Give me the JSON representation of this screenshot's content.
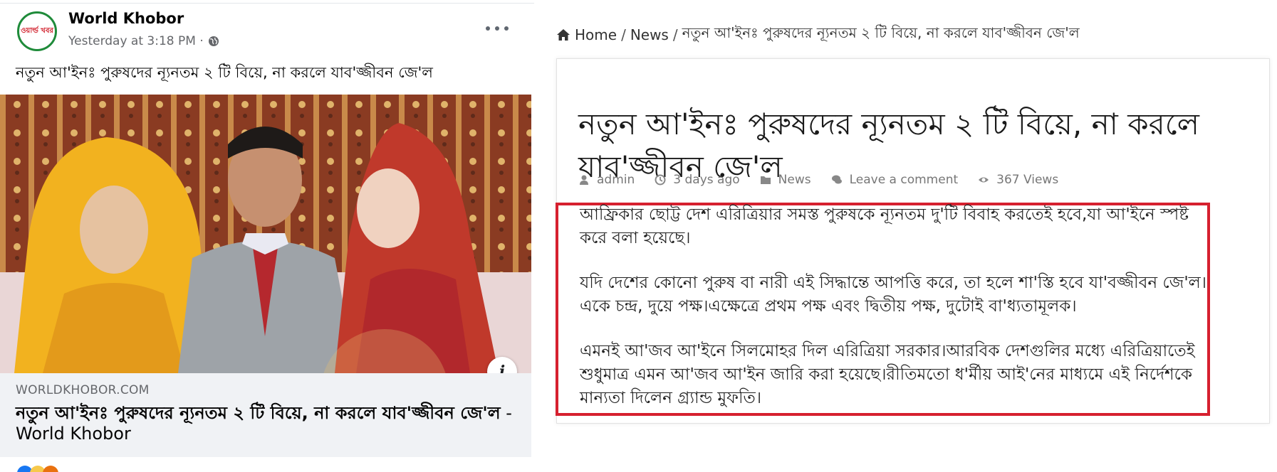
{
  "post": {
    "page_name": "World Khobor",
    "avatar_text": "ওয়ার্ল্ড খবর",
    "timestamp": "Yesterday at 3:18 PM ·",
    "more_icon": "more-horizontal-icon",
    "caption": "নতুন আ'ইনঃ পুরুষদের ন্যূনতম ২ টি বিয়ে, না করলে যাব'জ্জীবন জে'ল",
    "link_card": {
      "domain": "WORLDKHOBOR.COM",
      "title": "নতুন আ'ইনঃ পুরুষদের ন্যূনতম ২ টি বিয়ে, না করলে যাব'জ্জীবন জে'ল",
      "site_suffix": " - World Khobor"
    },
    "info_icon": "i"
  },
  "article": {
    "breadcrumb": {
      "home": "Home",
      "sep": "/",
      "news": "News",
      "current": "নতুন আ'ইনঃ পুরুষদের ন্যূনতম ২ টি বিয়ে, না করলে যাব'জ্জীবন জে'ল"
    },
    "title": "নতুন আ'ইনঃ পুরুষদের ন্যূনতম ২ টি বিয়ে, না করলে যাব'জ্জীবন জে'ল",
    "meta": {
      "author": "admin",
      "date": "3 days ago",
      "category": "News",
      "comment": "Leave a comment",
      "views": "367 Views"
    },
    "paragraphs": [
      "আফ্রিকার ছোট্ট দেশ এরিত্রিয়ার সমস্ত পুরুষকে ন্যূনতম দু'টি বিবাহ করতেই হবে,যা আ'ইনে স্পষ্ট করে বলা হয়েছে।",
      "যদি দেশের কোনো পুরুষ বা নারী এই সিদ্ধান্তে আপত্তি করে, তা হলে শা'স্তি হবে যা'বজ্জীবন জে'ল।একে চন্দ্র, দুয়ে পক্ষ।এক্ষেত্রে প্রথম পক্ষ এবং দ্বিতীয় পক্ষ, দুটোই বা'ধ্যতামূলক।",
      "এমনই আ'জব আ'ইনে সিলমোহর দিল এরিত্রিয়া সরকার।আরবিক দেশগুলির মধ্যে এরিত্রিয়াতেই শুধুমাত্র এমন আ'জব আ'ইন জারি করা হয়েছে।রীতিমতো ধ'র্মীয় আই'নের মাধ্যমে এই নির্দেশকে মান্যতা দিলেন গ্র্যান্ড মুফতি।"
    ]
  },
  "colors": {
    "highlight_border": "#d6202f",
    "link_card_bg": "#f0f2f5",
    "avatar_border": "#1f8b3a",
    "avatar_text": "#d11f2b"
  }
}
